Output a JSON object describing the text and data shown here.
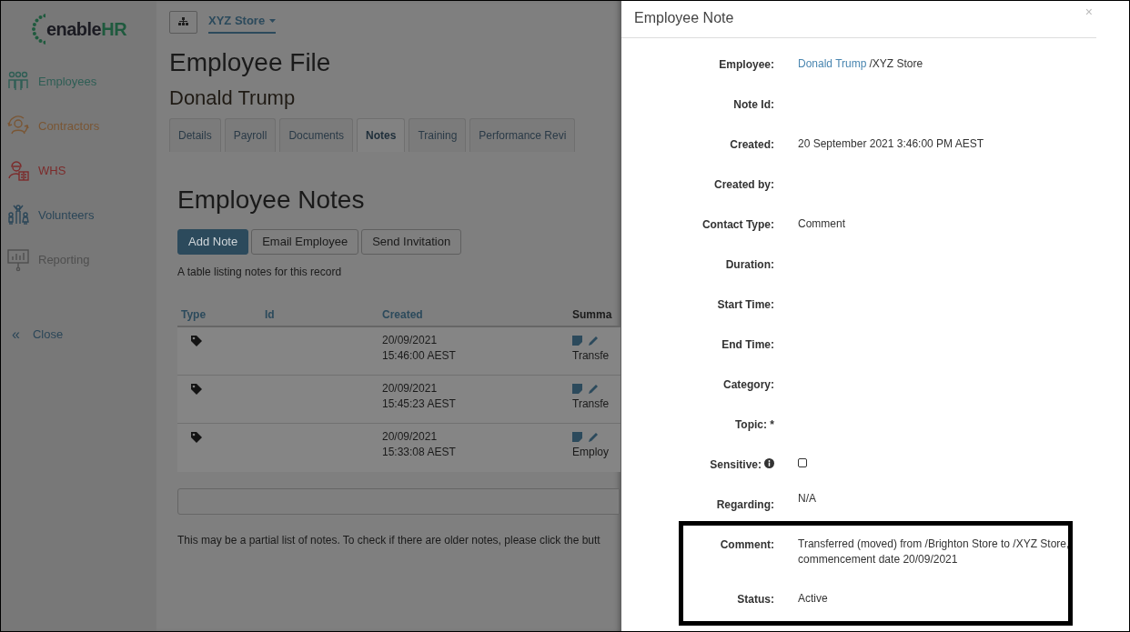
{
  "logo": {
    "prefix": "enable",
    "suffix": "HR"
  },
  "sidebar": {
    "items": [
      {
        "label": "Employees",
        "color": "#2f5e55"
      },
      {
        "label": "Contractors",
        "color": "#7a5634"
      },
      {
        "label": "WHS",
        "color": "#7c2b2b"
      },
      {
        "label": "Volunteers",
        "color": "#2b4658"
      },
      {
        "label": "Reporting",
        "color": "#4f4f4f"
      }
    ],
    "close": {
      "glyph": "«",
      "label": "Close"
    }
  },
  "topbar": {
    "store": "XYZ Store"
  },
  "page_title": "Employee File",
  "employee_name": "Donald Trump",
  "tabs": [
    {
      "label": "Details",
      "selected": false
    },
    {
      "label": "Payroll",
      "selected": false
    },
    {
      "label": "Documents",
      "selected": false
    },
    {
      "label": "Notes",
      "selected": true
    },
    {
      "label": "Training",
      "selected": false
    },
    {
      "label": "Performance Revi",
      "selected": false
    }
  ],
  "notes": {
    "title": "Employee Notes",
    "buttons": [
      {
        "label": "Add Note",
        "kind": "primary"
      },
      {
        "label": "Email Employee",
        "kind": "default"
      },
      {
        "label": "Send Invitation",
        "kind": "default"
      }
    ],
    "caption": "A table listing notes for this record",
    "table": {
      "columns": [
        "Type",
        "Id",
        "Created",
        "Summa"
      ],
      "rows": [
        {
          "created": [
            "20/09/2021",
            "15:46:00 AEST"
          ],
          "summary": "Transfe"
        },
        {
          "created": [
            "20/09/2021",
            "15:45:23 AEST"
          ],
          "summary": "Transfe"
        },
        {
          "created": [
            "20/09/2021",
            "15:33:08 AEST"
          ],
          "summary": "Employ"
        }
      ]
    },
    "footer": "This may be a partial list of notes. To check if there are older notes, please click the butt"
  },
  "drawer": {
    "title": "Employee Note",
    "close": "×",
    "fields": [
      {
        "label": "Employee:",
        "kind": "link",
        "link": "Donald Trump",
        "value": "/XYZ Store"
      },
      {
        "label": "Note Id:",
        "kind": "empty"
      },
      {
        "label": "Created:",
        "kind": "text",
        "value": "20 September 2021 3:46:00 PM AEST"
      },
      {
        "label": "Created by:",
        "kind": "empty"
      },
      {
        "label": "Contact Type:",
        "kind": "text",
        "value": "Comment"
      },
      {
        "label": "Duration:",
        "kind": "empty"
      },
      {
        "label": "Start Time:",
        "kind": "empty"
      },
      {
        "label": "End Time:",
        "kind": "empty"
      },
      {
        "label": "Category:",
        "kind": "empty"
      },
      {
        "label": "Topic: *",
        "kind": "empty"
      },
      {
        "label": "Sensitive:",
        "kind": "checkbox",
        "checked": false,
        "info": true
      },
      {
        "label": "Regarding:",
        "kind": "raised",
        "value": "N/A"
      },
      {
        "label": "Comment:",
        "kind": "text",
        "value": "Transferred (moved) from /Brighton Store to /XYZ Store, commencement date 20/09/2021"
      },
      {
        "label": "Status:",
        "kind": "text",
        "value": "Active"
      }
    ]
  }
}
